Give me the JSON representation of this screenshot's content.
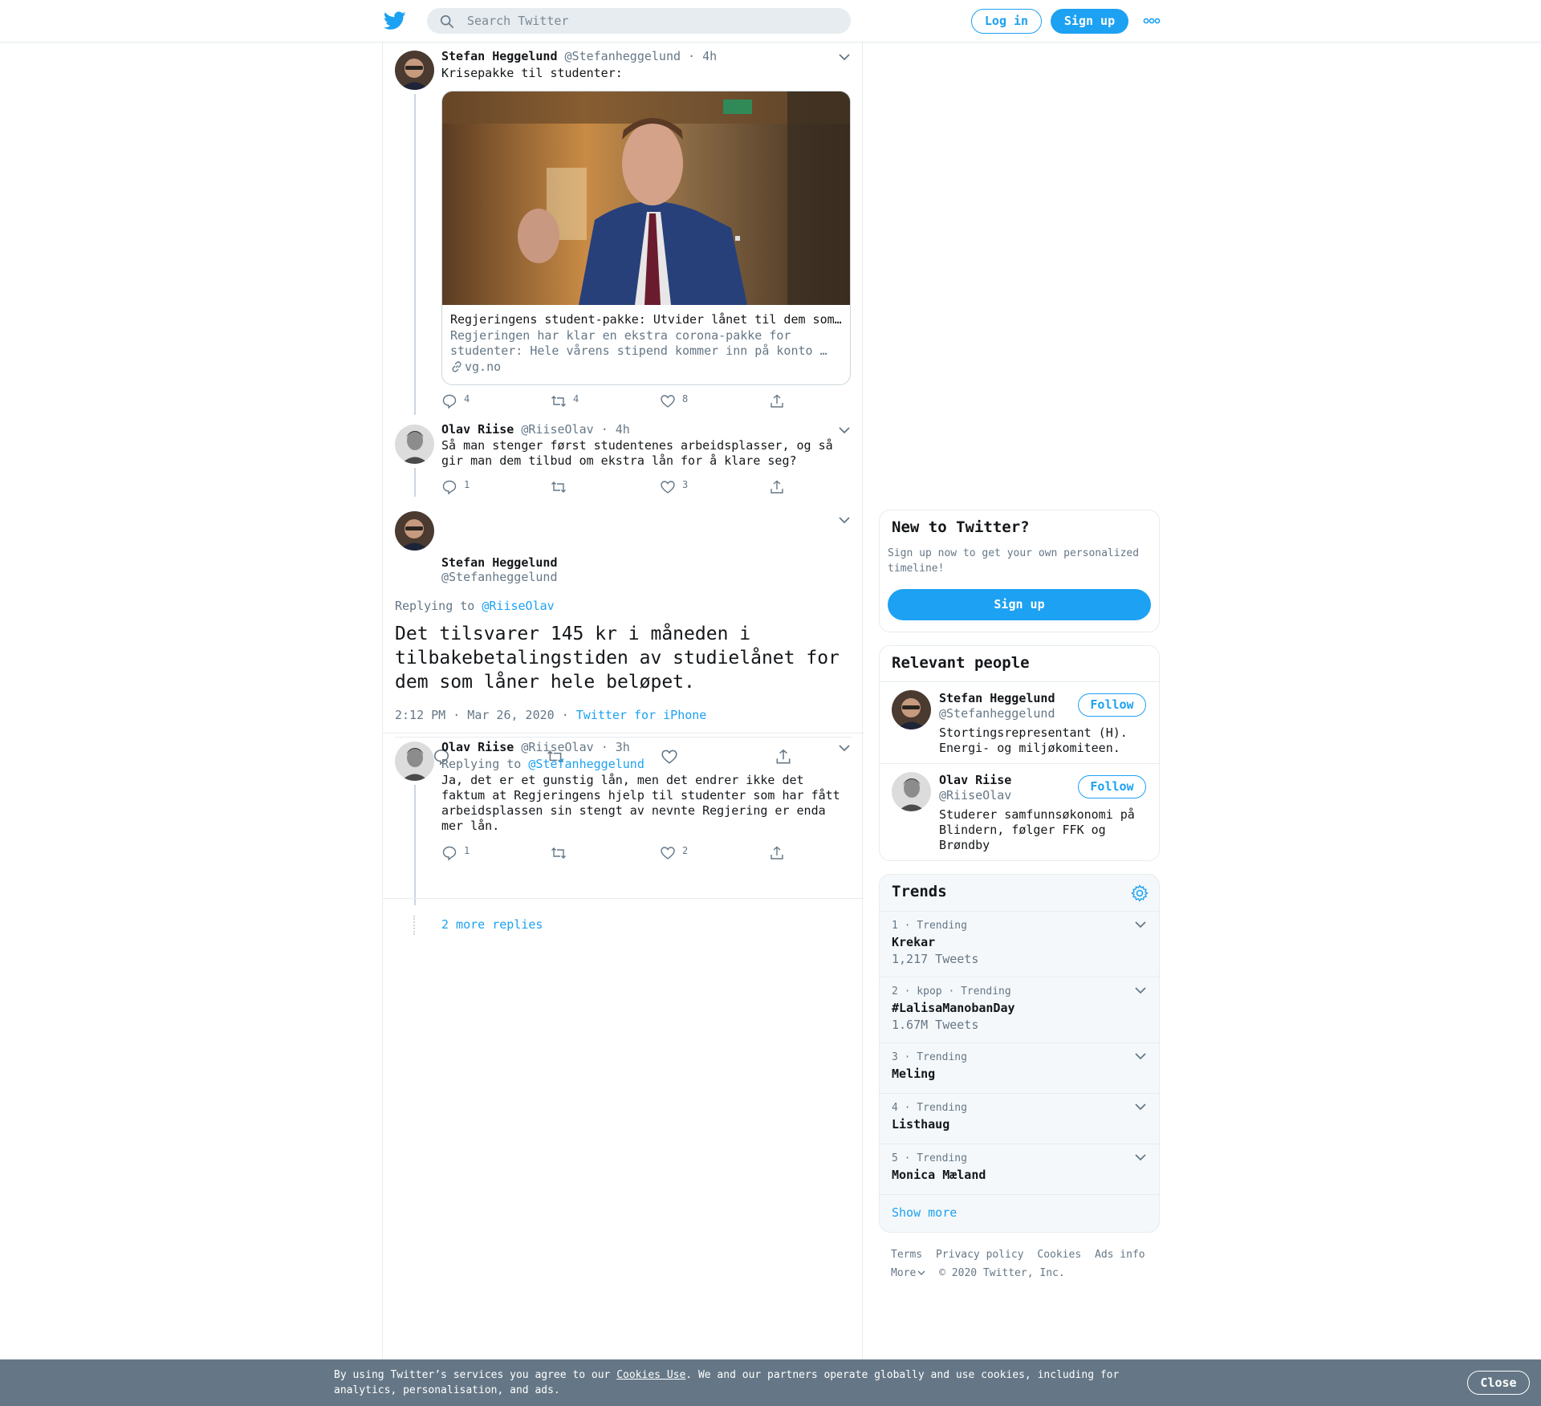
{
  "header": {
    "search_placeholder": "Search Twitter",
    "login_label": "Log in",
    "signup_label": "Sign up",
    "icons": [
      "twitter-bird-icon",
      "search-icon",
      "more-dots-icon"
    ],
    "accent_color": "#1da1f2"
  },
  "tweets": [
    {
      "name": "Stefan Heggelund",
      "handle": "@Stefanheggelund",
      "dot": "·",
      "time": "4h",
      "text": "Krisepakke til studenter:",
      "card": {
        "title": "Regjeringens student-pakke: Utvider lånet til dem som…",
        "description": "Regjeringen har klar en ekstra corona-pakke for studenter: Hele vårens stipend kommer inn på konto …",
        "domain": "vg.no"
      },
      "replies": "4",
      "retweets": "4",
      "likes": "8"
    },
    {
      "name": "Olav Riise",
      "handle": "@RiiseOlav",
      "dot": "·",
      "time": "4h",
      "text": "Så man stenger først studentenes arbeidsplasser, og så gir man dem tilbud om ekstra lån for å klare seg?",
      "replies": "1",
      "retweets": "",
      "likes": "3"
    }
  ],
  "focus": {
    "name": "Stefan Heggelund",
    "handle": "@Stefanheggelund",
    "replying_prefix": "Replying to",
    "replying_to": "@RiiseOlav",
    "text": "Det tilsvarer 145 kr i måneden i tilbakebetalingstiden av studielånet for dem som låner hele beløpet.",
    "timestamp": "2:12 PM · Mar 26, 2020",
    "meta_dot": "·",
    "source": "Twitter for iPhone"
  },
  "reply": {
    "name": "Olav Riise",
    "handle": "@RiiseOlav",
    "dot": "·",
    "time": "3h",
    "replying_prefix": "Replying to",
    "replying_to": "@Stefanheggelund",
    "text": "Ja, det er et gunstig lån, men det endrer ikke det faktum at Regjeringens hjelp til studenter som har fått arbeidsplassen sin stengt av nevnte Regjering er enda mer lån.",
    "replies": "1",
    "retweets": "",
    "likes": "2",
    "more_replies": "2 more replies"
  },
  "new_to_twitter": {
    "title": "New to Twitter?",
    "subtitle": "Sign up now to get your own personalized timeline!",
    "button": "Sign up"
  },
  "relevant_people": {
    "title": "Relevant people",
    "follow_label": "Follow",
    "people": [
      {
        "name": "Stefan Heggelund",
        "handle": "@Stefanheggelund",
        "bio": "Stortingsrepresentant (H). Energi- og miljøkomiteen."
      },
      {
        "name": "Olav Riise",
        "handle": "@RiiseOlav",
        "bio": "Studerer samfunnsøkonomi på Blindern, følger FFK og Brøndby"
      }
    ]
  },
  "trends": {
    "title": "Trends",
    "items": [
      {
        "meta": "1 · Trending",
        "name": "Krekar",
        "count": "1,217 Tweets"
      },
      {
        "meta": "2 · kpop · Trending",
        "name": "#LalisaManobanDay",
        "count": "1.67M Tweets"
      },
      {
        "meta": "3 · Trending",
        "name": "Meling",
        "count": ""
      },
      {
        "meta": "4 · Trending",
        "name": "Listhaug",
        "count": ""
      },
      {
        "meta": "5 · Trending",
        "name": "Monica Mæland",
        "count": ""
      }
    ],
    "show_more": "Show more"
  },
  "footer": {
    "links": [
      "Terms",
      "Privacy policy",
      "Cookies",
      "Ads info"
    ],
    "more": "More",
    "copyright": "© 2020 Twitter, Inc."
  },
  "cookie_banner": {
    "text_before": "By using Twitter’s services you agree to our ",
    "link": "Cookies Use",
    "text_after": ". We and our partners operate globally and use cookies, including for analytics, personalisation, and ads.",
    "close": "Close"
  }
}
